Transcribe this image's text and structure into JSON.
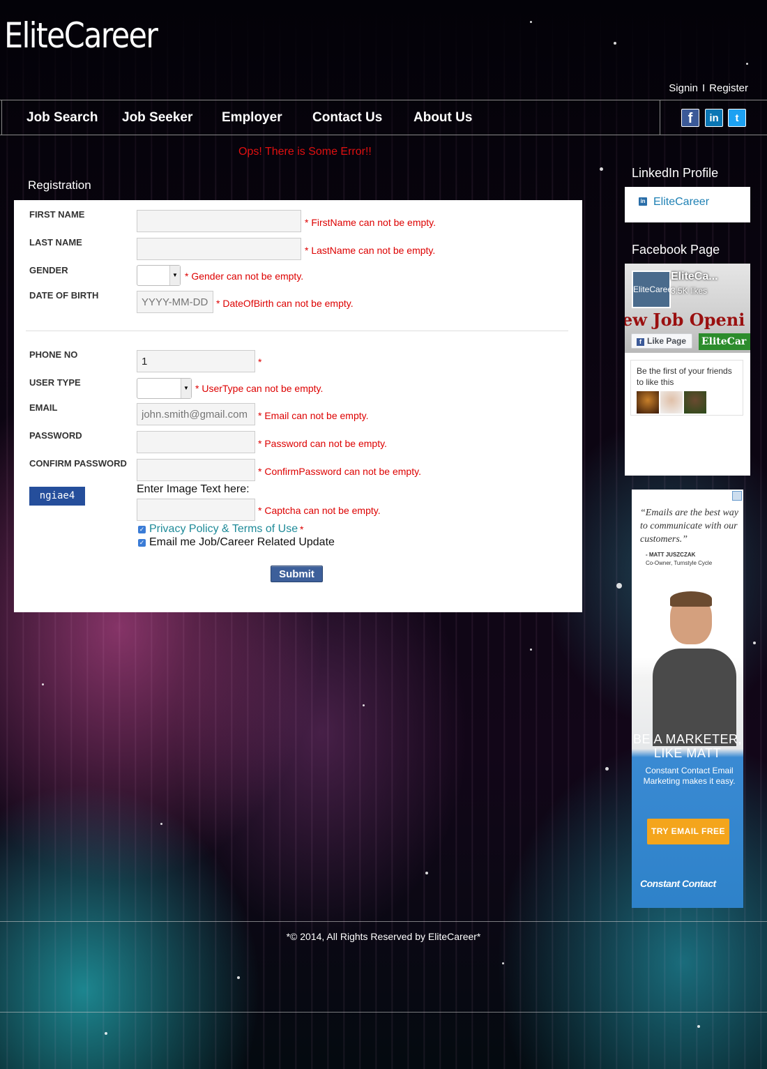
{
  "site": {
    "logo": "EliteCareer"
  },
  "auth": {
    "signin": "Signin",
    "separator": "I",
    "register": "Register"
  },
  "nav": {
    "items": [
      "Job Search",
      "Job Seeker",
      "Employer",
      "Contact Us",
      "About Us"
    ],
    "social": {
      "facebook": "f",
      "linkedin": "in",
      "twitter": "t"
    }
  },
  "error_banner": "Ops! There is Some Error!!",
  "registration": {
    "title": "Registration",
    "fields": {
      "first_name": {
        "label": "FIRST NAME",
        "value": "",
        "error": "* FirstName can not be empty."
      },
      "last_name": {
        "label": "LAST NAME",
        "value": "",
        "error": "* LastName can not be empty."
      },
      "gender": {
        "label": "GENDER",
        "value": "",
        "error": "* Gender can not be empty."
      },
      "dob": {
        "label": "DATE OF BIRTH",
        "placeholder": "YYYY-MM-DD",
        "error": "* DateOfBirth can not be empty."
      },
      "phone": {
        "label": "PHONE NO",
        "value": "1",
        "error": "*"
      },
      "user_type": {
        "label": "USER TYPE",
        "value": "",
        "error": "* UserType can not be empty."
      },
      "email": {
        "label": "EMAIL",
        "placeholder": "john.smith@gmail.com",
        "error": "* Email can not be empty."
      },
      "password": {
        "label": "PASSWORD",
        "value": "",
        "error": "* Password can not be empty."
      },
      "confirm_password": {
        "label": "CONFIRM PASSWORD",
        "value": "",
        "error": "* ConfirmPassword can not be empty."
      },
      "captcha": {
        "image_text": "ngiae4",
        "prompt": "Enter Image Text here:",
        "value": "",
        "error": "* Captcha can not be empty."
      }
    },
    "privacy": {
      "label": "Privacy Policy & Terms of Use",
      "required": "*",
      "checked": true
    },
    "updates": {
      "label": "Email me Job/Career Related Update",
      "checked": true
    },
    "submit": "Submit"
  },
  "sidebar": {
    "linkedin": {
      "title": "LinkedIn Profile",
      "icon": "in",
      "name": "EliteCareer"
    },
    "facebook": {
      "title": "Facebook Page",
      "page_name": "EliteCa...",
      "likes": "3.5K likes",
      "pic_text": "EliteCareer",
      "cover_text": "ew Job Openi",
      "like_button": "Like Page",
      "mini_logo": "EliteCar",
      "friends_text": "Be the first of your friends to like this"
    },
    "ad": {
      "quote": "“Emails are the best way to communicate with our customers.”",
      "quote_name": "- MATT JUSZCZAK",
      "quote_role": "Co-Owner, Turnstyle Cycle",
      "headline": "BE A MARKETER, LIKE MATT",
      "sub": "Constant Contact Email Marketing makes it easy.",
      "cta": "TRY EMAIL FREE",
      "brand": "Constant Contact"
    }
  },
  "footer": "*© 2014, All Rights Reserved by EliteCareer*",
  "colors": {
    "error": "#d00000",
    "submit": "#3d5f9a",
    "link": "#1e8a98",
    "captcha": "#254e9b"
  }
}
